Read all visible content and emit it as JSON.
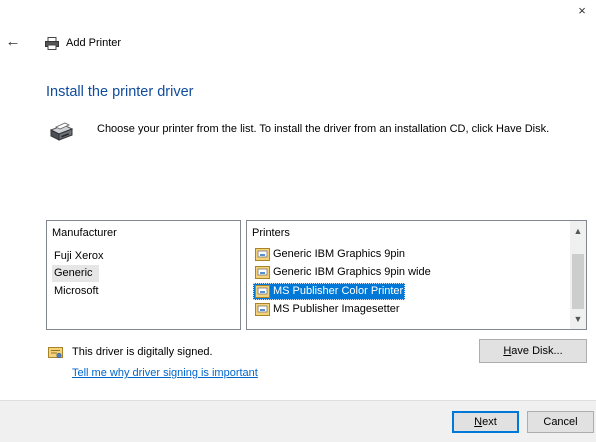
{
  "window": {
    "close_glyph": "×",
    "back_glyph": "←",
    "title": "Add Printer"
  },
  "heading": "Install the printer driver",
  "instructions": "Choose your printer from the list. To install the driver from an installation CD, click Have Disk.",
  "manufacturer_list": {
    "header": "Manufacturer",
    "items": [
      "Fuji Xerox",
      "Generic",
      "Microsoft"
    ],
    "selected": "Generic"
  },
  "printers_list": {
    "header": "Printers",
    "items": [
      "Generic IBM Graphics 9pin",
      "Generic IBM Graphics 9pin wide",
      "MS Publisher Color Printer",
      "MS Publisher Imagesetter"
    ],
    "selected": "MS Publisher Color Printer"
  },
  "signature": {
    "status_text": "This driver is digitally signed.",
    "link_text": "Tell me why driver signing is important"
  },
  "buttons": {
    "have_disk_mnemonic": "H",
    "have_disk_rest": "ave Disk...",
    "next_mnemonic": "N",
    "next_rest": "ext",
    "cancel": "Cancel"
  },
  "colors": {
    "heading": "#0f4c9b",
    "selection": "#0078d7",
    "link": "#0066cc"
  },
  "icons": {
    "back": "back-arrow-icon",
    "printer_small": "printer-icon",
    "printer_large": "printer-driver-icon",
    "printer_item": "printer-item-icon",
    "certificate": "certificate-icon"
  }
}
